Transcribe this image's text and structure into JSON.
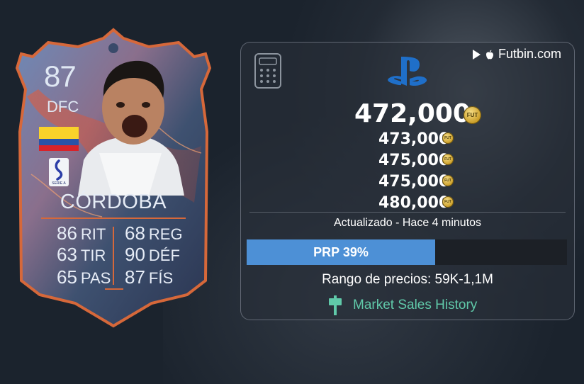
{
  "card": {
    "rating": "87",
    "position": "DFC",
    "name": "CÓRDOBA",
    "flag_colors": [
      "#f9d22a",
      "#2a53a8",
      "#d8232a"
    ],
    "league_badge": "SERIE A",
    "stats": [
      {
        "value": "86",
        "label": "RIT"
      },
      {
        "value": "63",
        "label": "TIR"
      },
      {
        "value": "65",
        "label": "PAS"
      },
      {
        "value": "68",
        "label": "REG"
      },
      {
        "value": "90",
        "label": "DÉF"
      },
      {
        "value": "87",
        "label": "FÍS"
      }
    ],
    "accent_color": "#e8743a"
  },
  "panel": {
    "brand": "Futbin.com",
    "brand_icons": [
      "google-play-icon",
      "apple-icon"
    ],
    "platform_icon": "playstation-icon",
    "calculator_icon": "calculator-icon",
    "price_main": "472,000",
    "prices": [
      "473,000",
      "475,000",
      "475,000",
      "480,000"
    ],
    "coin_label": "FUT",
    "updated": "Actualizado - Hace 4 minutos",
    "prp_label": "PRP 39%",
    "prp_fraction": 0.39,
    "prp_color": "#4d90d6",
    "range": "Rango de precios: 59K-1,1M",
    "market_link": "Market Sales History",
    "market_link_color": "#60c9a9"
  }
}
